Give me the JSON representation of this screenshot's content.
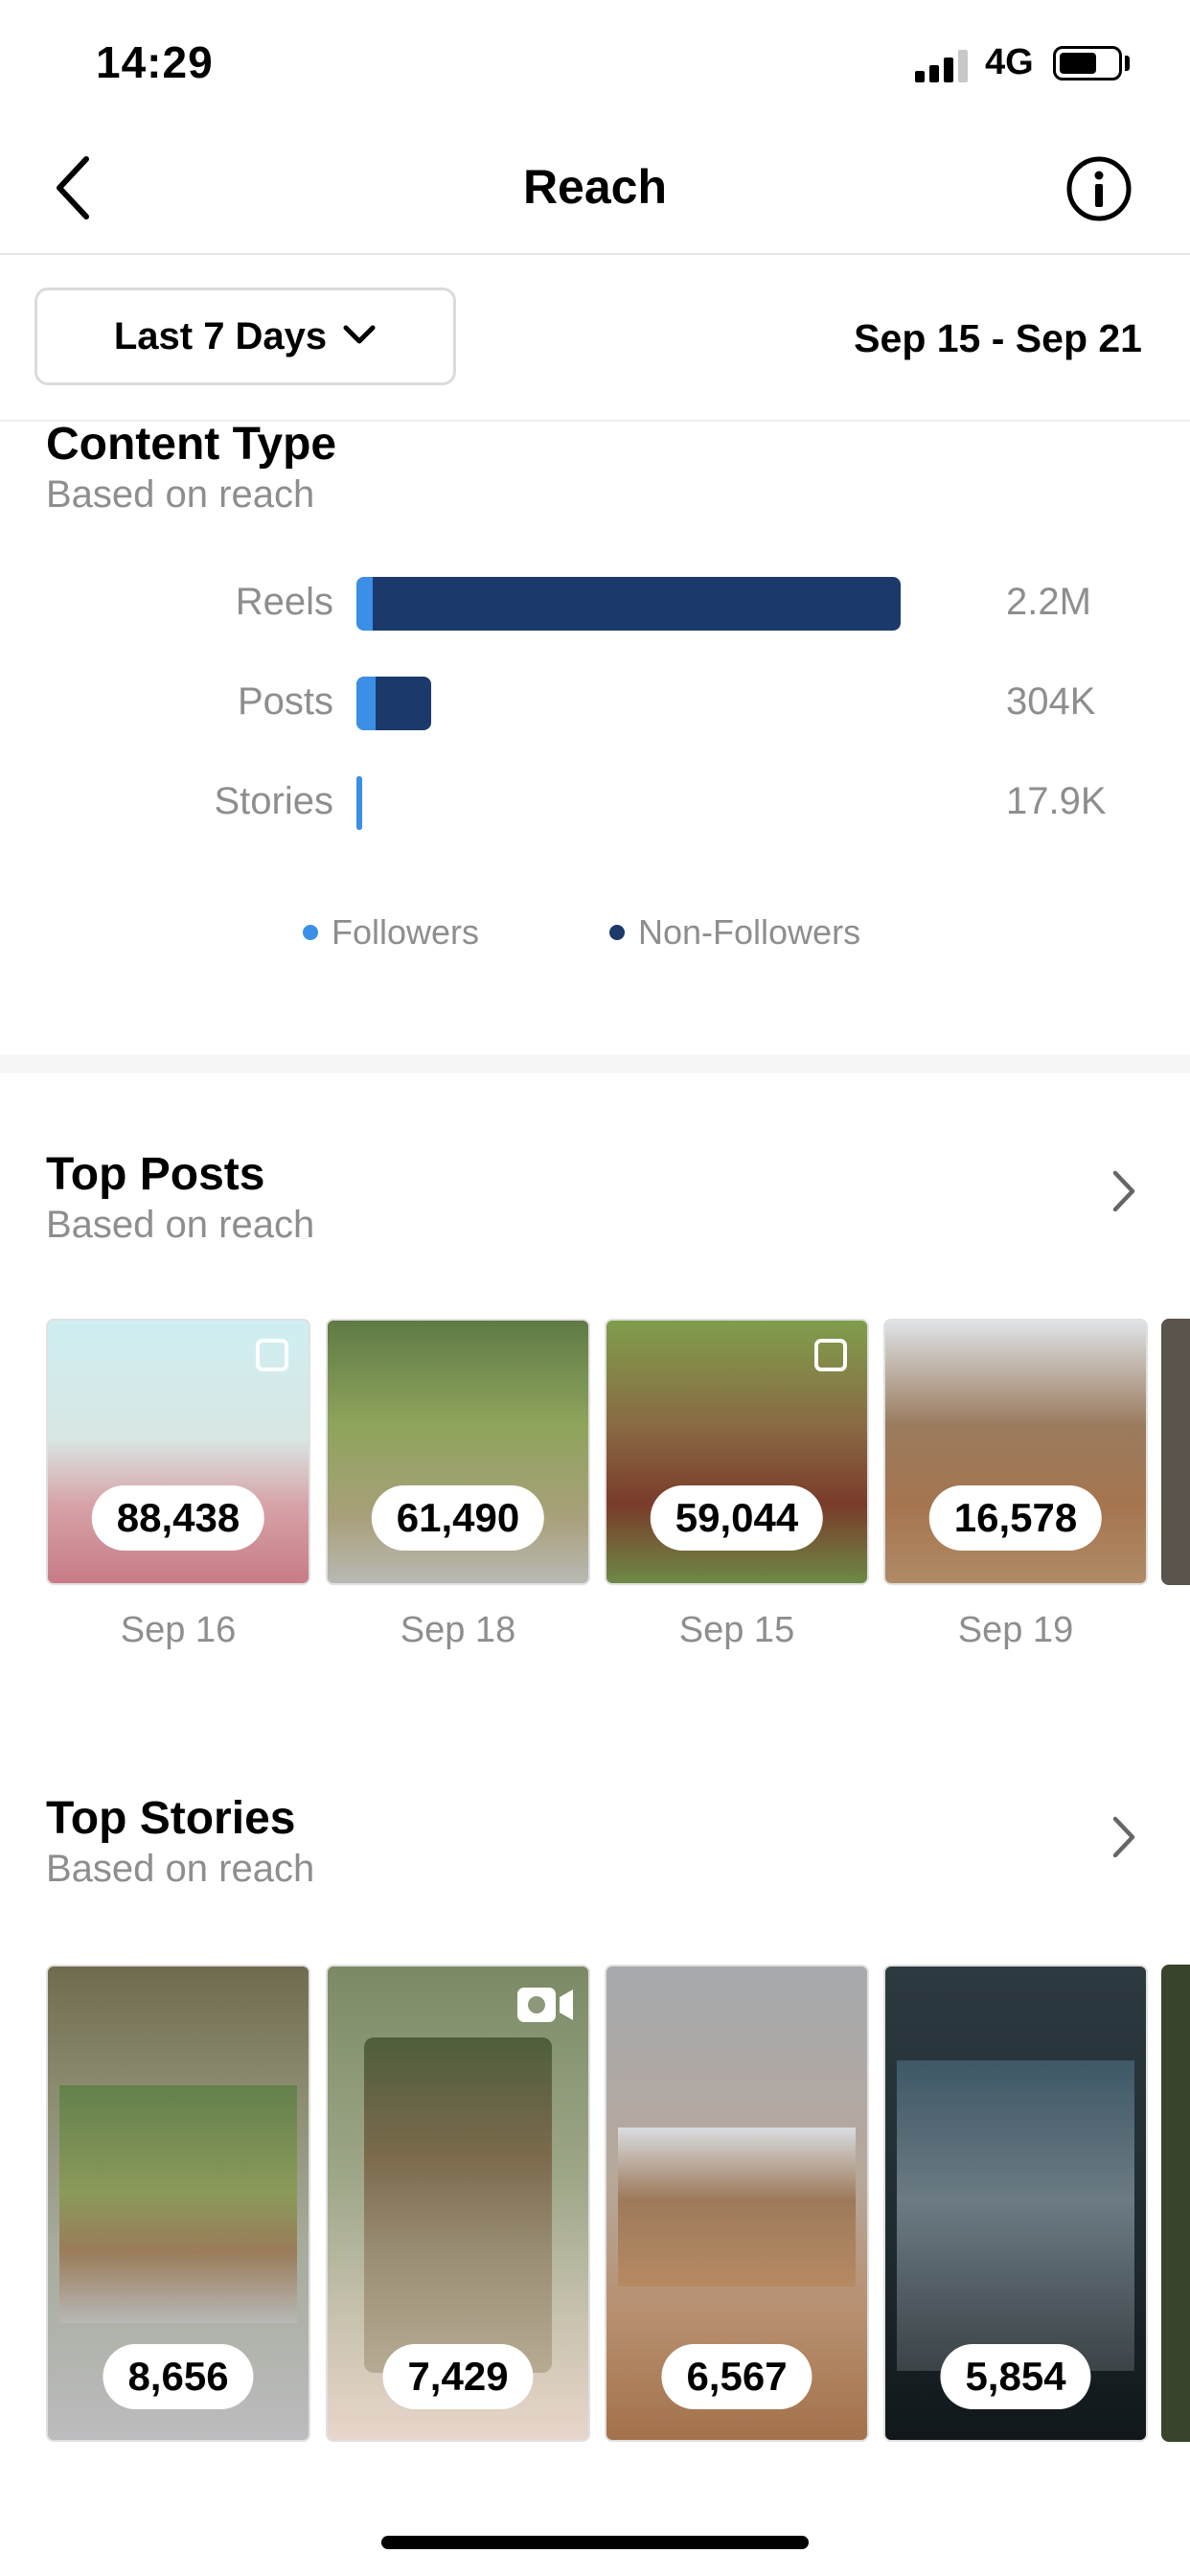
{
  "status_bar": {
    "time": "14:29",
    "network": "4G"
  },
  "header": {
    "title": "Reach"
  },
  "filter": {
    "range_label": "Last 7 Days",
    "date_range": "Sep 15 - Sep 21"
  },
  "content_type": {
    "title": "Content Type",
    "subtitle": "Based on reach",
    "rows": [
      {
        "label": "Reels",
        "value": "2.2M",
        "followers_fraction": 0.03,
        "total_fraction": 1.0
      },
      {
        "label": "Posts",
        "value": "304K",
        "followers_fraction": 0.25,
        "total_fraction": 0.138
      },
      {
        "label": "Stories",
        "value": "17.9K",
        "followers_fraction": 1.0,
        "total_fraction": 0.008
      }
    ],
    "legend": {
      "followers": "Followers",
      "non_followers": "Non-Followers"
    },
    "colors": {
      "followers": "#3b8fe6",
      "non_followers": "#1b3a6b"
    }
  },
  "top_posts": {
    "title": "Top Posts",
    "subtitle": "Based on reach",
    "items": [
      {
        "value": "88,438",
        "date": "Sep 16",
        "multi": true
      },
      {
        "value": "61,490",
        "date": "Sep 18",
        "multi": false
      },
      {
        "value": "59,044",
        "date": "Sep 15",
        "multi": true
      },
      {
        "value": "16,578",
        "date": "Sep 19",
        "multi": false
      }
    ]
  },
  "top_stories": {
    "title": "Top Stories",
    "subtitle": "Based on reach",
    "items": [
      {
        "value": "8,656"
      },
      {
        "value": "7,429"
      },
      {
        "value": "6,567"
      },
      {
        "value": "5,854"
      }
    ]
  }
}
